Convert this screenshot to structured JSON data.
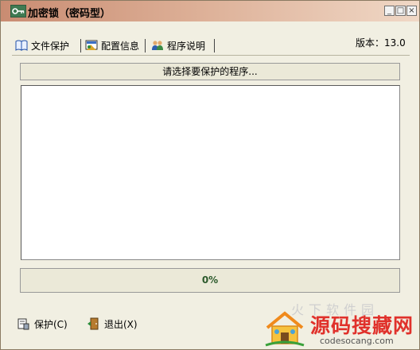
{
  "window": {
    "title": "加密锁（密码型）"
  },
  "title_controls": {
    "minimize": "_",
    "maximize": "□",
    "close": "×"
  },
  "version_label": "版本：13.0",
  "tabs": [
    {
      "label": "文件保护",
      "icon": "book-icon"
    },
    {
      "label": "配置信息",
      "icon": "config-icon"
    },
    {
      "label": "程序说明",
      "icon": "users-icon"
    }
  ],
  "prompt_text": "请选择要保护的程序...",
  "progress": {
    "text": "0%",
    "value": 0
  },
  "buttons": {
    "protect_label": "保护(C)",
    "exit_label": "退出(X)"
  },
  "watermark": {
    "faint_text": "火下软件园",
    "brand_text": "源码搜藏网",
    "url": "codesocang.com"
  },
  "colors": {
    "titlebar": "#c98c72",
    "progress_text": "#2c5a2c",
    "brand_red": "#e0312b"
  }
}
